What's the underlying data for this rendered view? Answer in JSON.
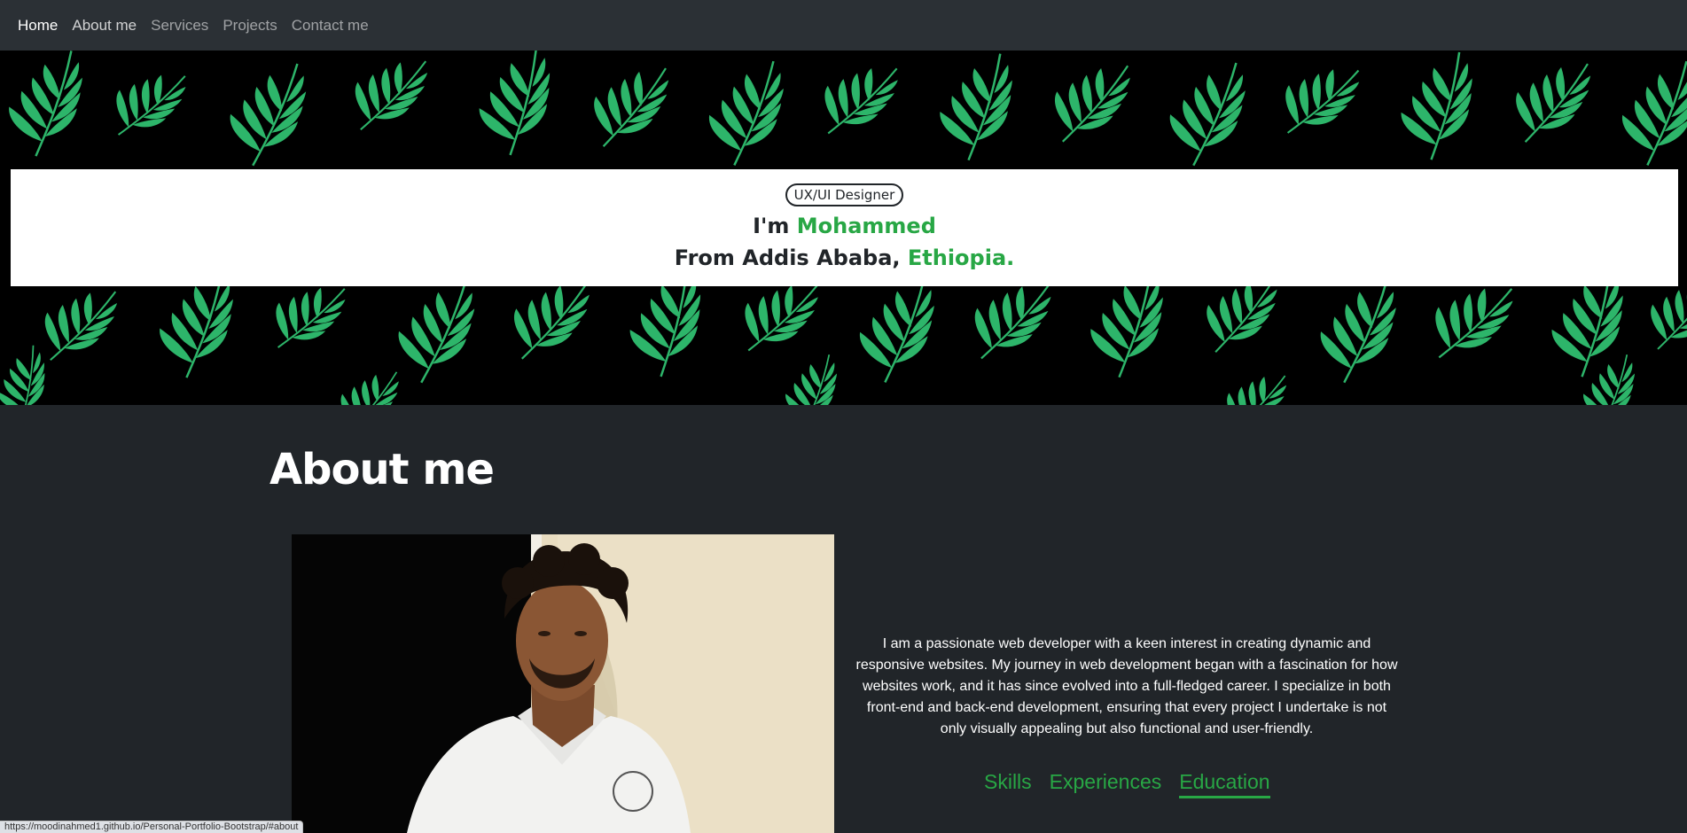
{
  "nav": {
    "items": [
      {
        "label": "Home"
      },
      {
        "label": "About me"
      },
      {
        "label": "Services"
      },
      {
        "label": "Projects"
      },
      {
        "label": "Contact me"
      }
    ]
  },
  "hero": {
    "badge": "UX/UI Designer",
    "line1_prefix": "I'm ",
    "line1_name": "Mohammed",
    "line2_prefix": "From Addis Ababa, ",
    "line2_country": "Ethiopia."
  },
  "about": {
    "title": "About me",
    "paragraph": "I am a passionate web developer with a keen interest in creating dynamic and responsive websites. My journey in web development began with a fascination for how websites work, and it has since evolved into a full-fledged career. I specialize in both front-end and back-end development, ensuring that every project I undertake is not only visually appealing but also functional and user-friendly.",
    "tabs": [
      {
        "label": "Skills",
        "active": false
      },
      {
        "label": "Experiences",
        "active": false
      },
      {
        "label": "Education",
        "active": true
      }
    ]
  },
  "status_url": "https://moodinahmed1.github.io/Personal-Portfolio-Bootstrap/#about",
  "colors": {
    "accent": "#28a745",
    "navbar": "#2b3035",
    "page_bg": "#212529",
    "leaf": "#2db56a"
  }
}
